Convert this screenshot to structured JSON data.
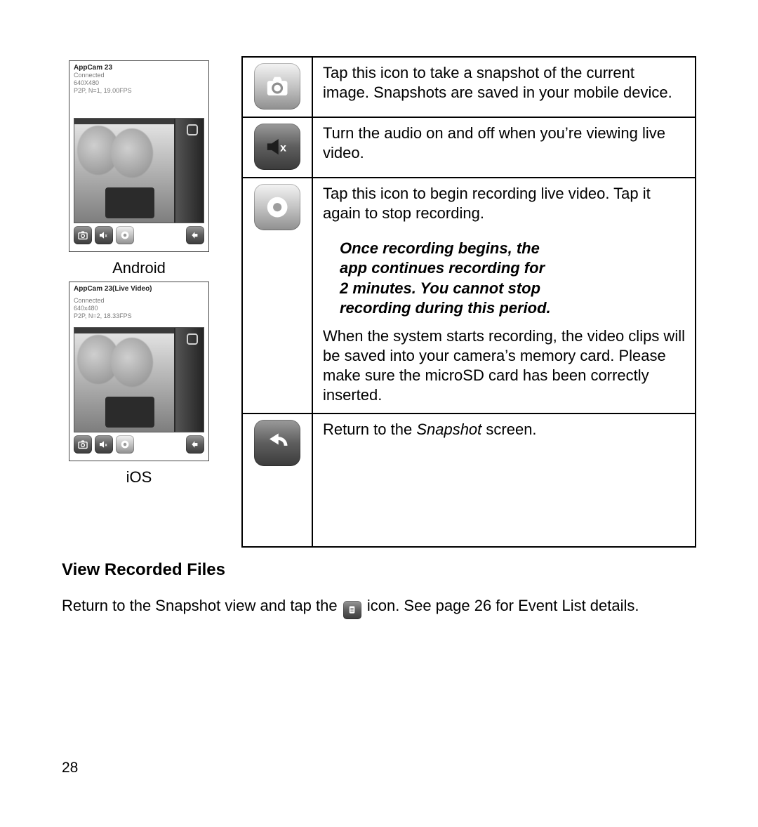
{
  "left": {
    "android": {
      "title": "AppCam 23",
      "connected": "Connected",
      "res": "640X480",
      "stats": "P2P, N=1, 19.00FPS",
      "caption": "Android"
    },
    "ios": {
      "title": "AppCam 23(Live Video)",
      "connected": "Connected",
      "res": "640x480",
      "stats": "P2P, N=2, 18.33FPS",
      "caption": "iOS"
    }
  },
  "table": {
    "row1": "Tap this icon to take a snapshot of the current image. Snapshots are saved in your mobile device.",
    "row2": "Turn the audio on and off when you’re viewing live video.",
    "row3a": "Tap this icon to begin recording live video. Tap it again to stop recording.",
    "row3note_l1": "Once recording begins, the",
    "row3note_l2": "app continues recording for",
    "row3note_l3": "2 minutes. You cannot stop",
    "row3note_l4": "recording during this period.",
    "row3b": "When the system starts recording, the video clips will be saved into your camera’s memory card. Please make sure the microSD card has been correctly inserted.",
    "row4_pre": "Return to the ",
    "row4_em": "Snapshot",
    "row4_post": " screen."
  },
  "section": {
    "heading": "View Recorded Files",
    "p_pre": "Return to the Snapshot view and tap the ",
    "p_post": " icon. See page 26 for Event List details."
  },
  "page_number": "28"
}
